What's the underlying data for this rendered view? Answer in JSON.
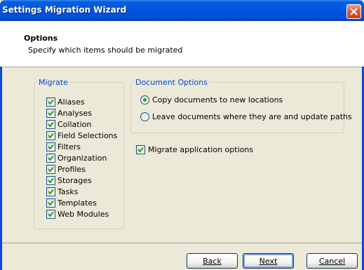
{
  "window": {
    "title": "Settings Migration Wizard"
  },
  "header": {
    "title": "Options",
    "subtitle": "Specify which items should be migrated"
  },
  "migrate": {
    "legend": "Migrate",
    "items": [
      {
        "label": "Aliases",
        "checked": true
      },
      {
        "label": "Analyses",
        "checked": true
      },
      {
        "label": "Collation",
        "checked": true
      },
      {
        "label": "Field Selections",
        "checked": true
      },
      {
        "label": "Filters",
        "checked": true
      },
      {
        "label": "Organization",
        "checked": true
      },
      {
        "label": "Profiles",
        "checked": true
      },
      {
        "label": "Storages",
        "checked": true
      },
      {
        "label": "Tasks",
        "checked": true
      },
      {
        "label": "Templates",
        "checked": true
      },
      {
        "label": "Web Modules",
        "checked": true
      }
    ]
  },
  "document_options": {
    "legend": "Document Options",
    "options": [
      {
        "label": "Copy documents to new locations",
        "selected": true
      },
      {
        "label": "Leave documents where they are and update paths",
        "selected": false
      }
    ]
  },
  "app_options": {
    "label": "Migrate application options",
    "checked": true
  },
  "buttons": {
    "back": "Back",
    "next": "Next",
    "cancel": "Cancel"
  }
}
